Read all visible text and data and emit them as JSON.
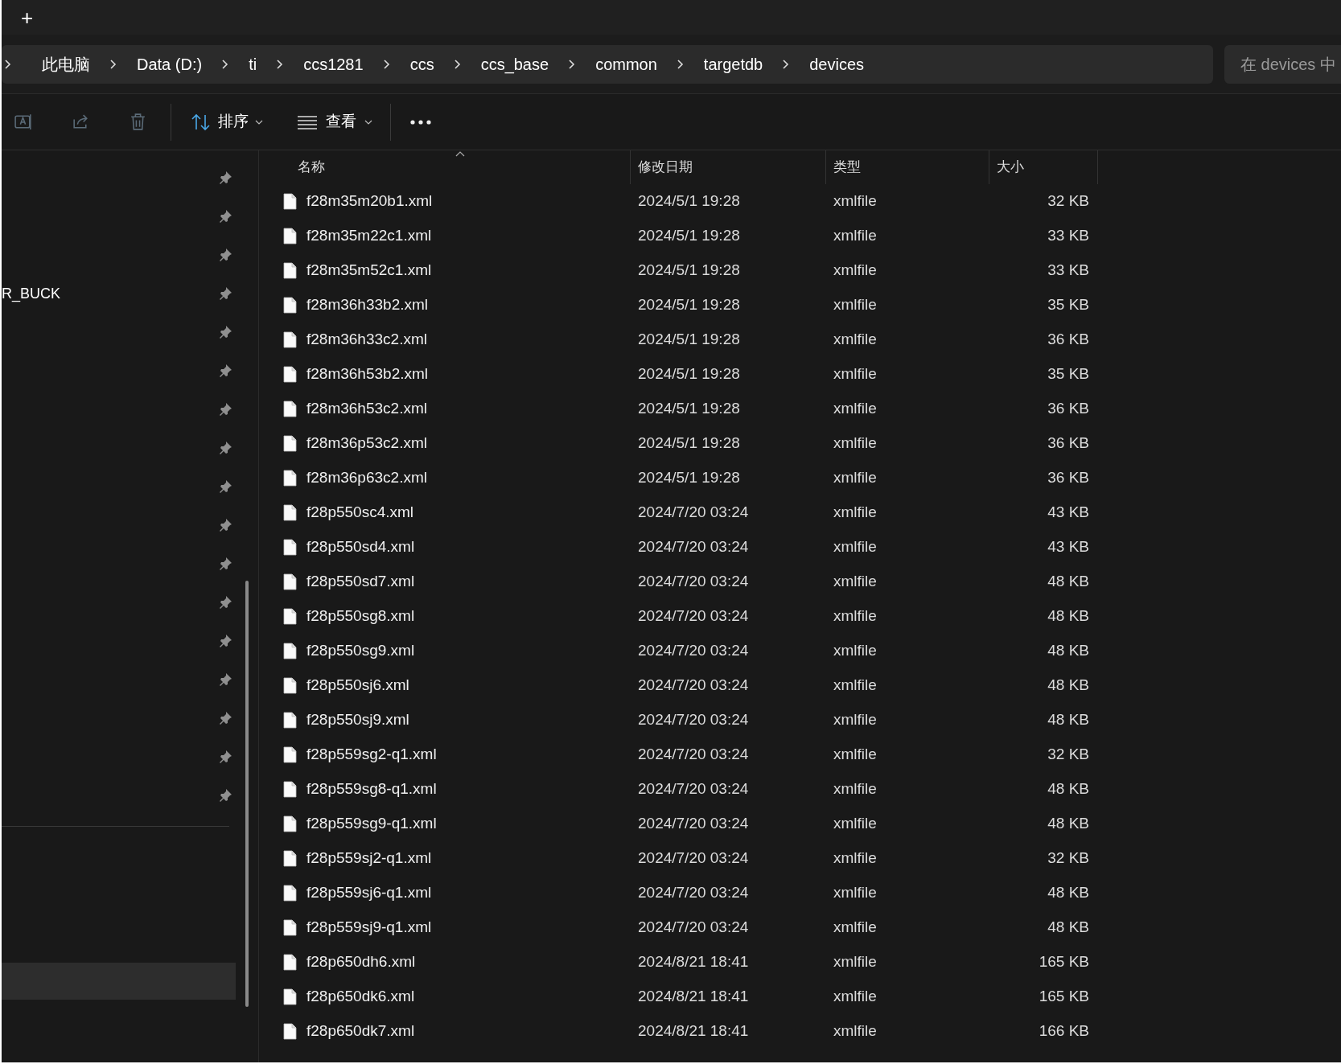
{
  "title_bar": {
    "new_tab": "+"
  },
  "breadcrumb": [
    "此电脑",
    "Data (D:)",
    "ti",
    "ccs1281",
    "ccs",
    "ccs_base",
    "common",
    "targetdb",
    "devices"
  ],
  "search": {
    "placeholder": "在 devices 中"
  },
  "toolbar": {
    "sort_label": "排序",
    "view_label": "查看"
  },
  "sidebar": {
    "quick_access": [
      {
        "pinned": true
      },
      {
        "pinned": true
      },
      {
        "pinned": true
      },
      {
        "pinned": true,
        "label": "R_BUCK"
      },
      {
        "pinned": true
      },
      {
        "pinned": true
      },
      {
        "pinned": true
      },
      {
        "pinned": true
      },
      {
        "pinned": true
      },
      {
        "pinned": true
      },
      {
        "pinned": true
      },
      {
        "pinned": true
      },
      {
        "pinned": true
      },
      {
        "pinned": true
      },
      {
        "pinned": true
      },
      {
        "pinned": true
      },
      {
        "pinned": true
      }
    ],
    "nav_items": [
      {
        "selected": true
      }
    ]
  },
  "table": {
    "columns": [
      "名称",
      "修改日期",
      "类型",
      "大小"
    ],
    "rows": [
      {
        "name": "f28m35m20b1.xml",
        "date": "2024/5/1 19:28",
        "type": "xmlfile",
        "size": "32 KB"
      },
      {
        "name": "f28m35m22c1.xml",
        "date": "2024/5/1 19:28",
        "type": "xmlfile",
        "size": "33 KB"
      },
      {
        "name": "f28m35m52c1.xml",
        "date": "2024/5/1 19:28",
        "type": "xmlfile",
        "size": "33 KB"
      },
      {
        "name": "f28m36h33b2.xml",
        "date": "2024/5/1 19:28",
        "type": "xmlfile",
        "size": "35 KB"
      },
      {
        "name": "f28m36h33c2.xml",
        "date": "2024/5/1 19:28",
        "type": "xmlfile",
        "size": "36 KB"
      },
      {
        "name": "f28m36h53b2.xml",
        "date": "2024/5/1 19:28",
        "type": "xmlfile",
        "size": "35 KB"
      },
      {
        "name": "f28m36h53c2.xml",
        "date": "2024/5/1 19:28",
        "type": "xmlfile",
        "size": "36 KB"
      },
      {
        "name": "f28m36p53c2.xml",
        "date": "2024/5/1 19:28",
        "type": "xmlfile",
        "size": "36 KB"
      },
      {
        "name": "f28m36p63c2.xml",
        "date": "2024/5/1 19:28",
        "type": "xmlfile",
        "size": "36 KB"
      },
      {
        "name": "f28p550sc4.xml",
        "date": "2024/7/20 03:24",
        "type": "xmlfile",
        "size": "43 KB"
      },
      {
        "name": "f28p550sd4.xml",
        "date": "2024/7/20 03:24",
        "type": "xmlfile",
        "size": "43 KB"
      },
      {
        "name": "f28p550sd7.xml",
        "date": "2024/7/20 03:24",
        "type": "xmlfile",
        "size": "48 KB"
      },
      {
        "name": "f28p550sg8.xml",
        "date": "2024/7/20 03:24",
        "type": "xmlfile",
        "size": "48 KB"
      },
      {
        "name": "f28p550sg9.xml",
        "date": "2024/7/20 03:24",
        "type": "xmlfile",
        "size": "48 KB"
      },
      {
        "name": "f28p550sj6.xml",
        "date": "2024/7/20 03:24",
        "type": "xmlfile",
        "size": "48 KB"
      },
      {
        "name": "f28p550sj9.xml",
        "date": "2024/7/20 03:24",
        "type": "xmlfile",
        "size": "48 KB"
      },
      {
        "name": "f28p559sg2-q1.xml",
        "date": "2024/7/20 03:24",
        "type": "xmlfile",
        "size": "32 KB"
      },
      {
        "name": "f28p559sg8-q1.xml",
        "date": "2024/7/20 03:24",
        "type": "xmlfile",
        "size": "48 KB"
      },
      {
        "name": "f28p559sg9-q1.xml",
        "date": "2024/7/20 03:24",
        "type": "xmlfile",
        "size": "48 KB"
      },
      {
        "name": "f28p559sj2-q1.xml",
        "date": "2024/7/20 03:24",
        "type": "xmlfile",
        "size": "32 KB"
      },
      {
        "name": "f28p559sj6-q1.xml",
        "date": "2024/7/20 03:24",
        "type": "xmlfile",
        "size": "48 KB"
      },
      {
        "name": "f28p559sj9-q1.xml",
        "date": "2024/7/20 03:24",
        "type": "xmlfile",
        "size": "48 KB"
      },
      {
        "name": "f28p650dh6.xml",
        "date": "2024/8/21 18:41",
        "type": "xmlfile",
        "size": "165 KB"
      },
      {
        "name": "f28p650dk6.xml",
        "date": "2024/8/21 18:41",
        "type": "xmlfile",
        "size": "165 KB"
      },
      {
        "name": "f28p650dk7.xml",
        "date": "2024/8/21 18:41",
        "type": "xmlfile",
        "size": "166 KB"
      }
    ]
  }
}
